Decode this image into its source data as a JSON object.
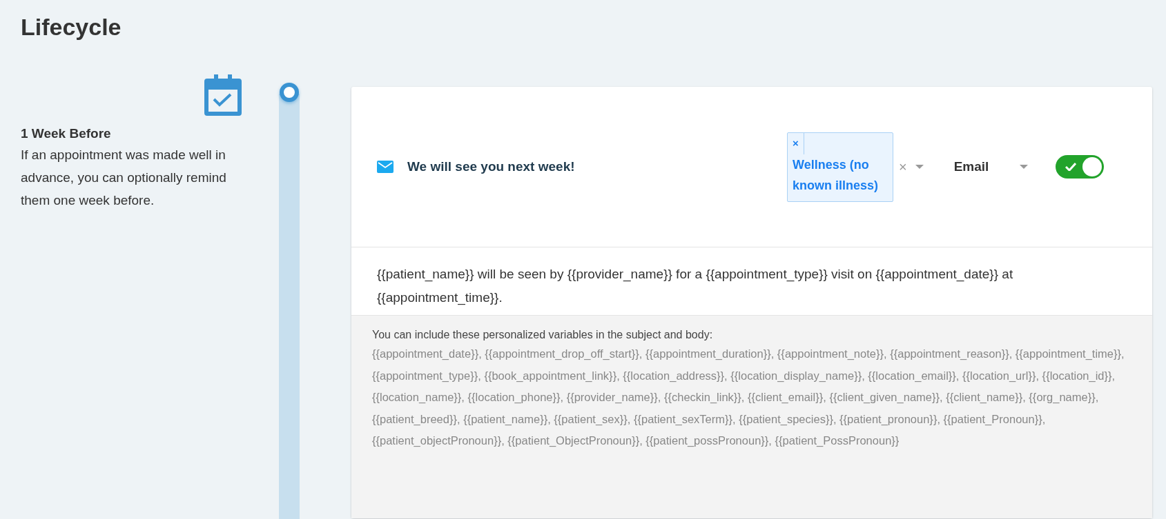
{
  "page": {
    "title": "Lifecycle"
  },
  "step": {
    "title": "1 Week Before",
    "description": "If an appointment was made well in advance, you can optionally remind them one week before."
  },
  "message": {
    "subject": "We will see you next week!",
    "tags": [
      {
        "remove": "×",
        "label": "Wellness (no known illness)"
      }
    ],
    "clear": "×",
    "channel": "Email",
    "enabled": true,
    "body": "{{patient_name}} will be seen by {{provider_name}} for a {{appointment_type}} visit on {{appointment_date}} at {{appointment_time}}.",
    "help": "You can include these personalized variables in the subject and body:",
    "variables": "{{appointment_date}}, {{appointment_drop_off_start}}, {{appointment_duration}}, {{appointment_note}}, {{appointment_reason}}, {{appointment_time}}, {{appointment_type}}, {{book_appointment_link}}, {{location_address}}, {{location_display_name}}, {{location_email}}, {{location_url}}, {{location_id}}, {{location_name}}, {{location_phone}}, {{provider_name}}, {{checkin_link}}, {{client_email}}, {{client_given_name}}, {{client_name}}, {{org_name}}, {{patient_breed}}, {{patient_name}}, {{patient_sex}}, {{patient_sexTerm}}, {{patient_species}}, {{patient_pronoun}}, {{patient_Pronoun}}, {{patient_objectPronoun}}, {{patient_ObjectPronoun}}, {{patient_possPronoun}}, {{patient_PossPronoun}}"
  }
}
